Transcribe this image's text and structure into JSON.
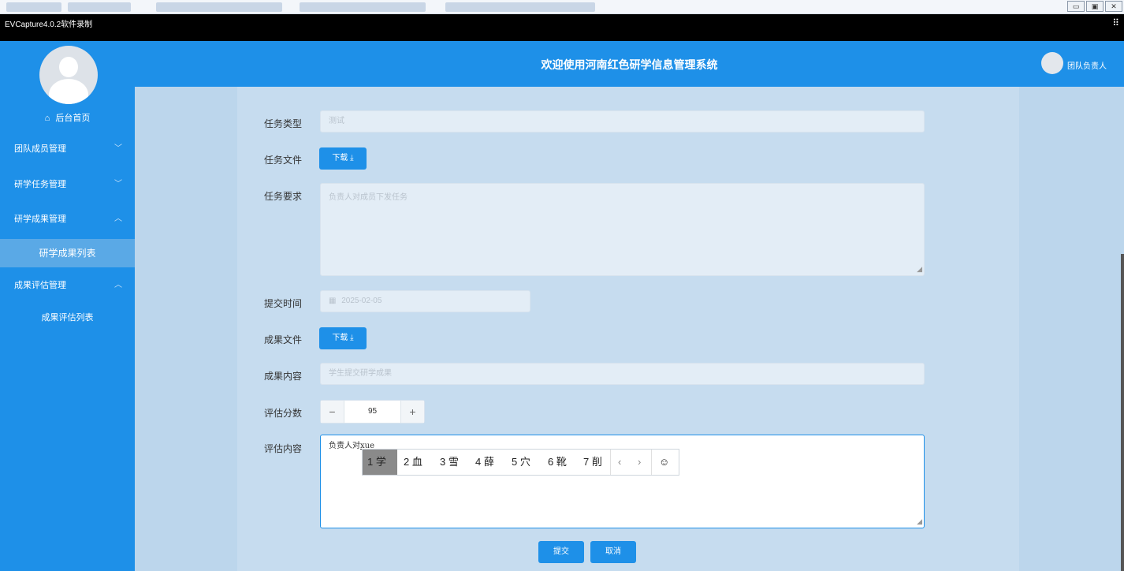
{
  "os": {
    "window_controls": [
      "▭",
      "▣",
      "✕"
    ]
  },
  "recorder": {
    "title": "EVCapture4.0.2软件录制",
    "icon": "fullscreen-exit-icon"
  },
  "header": {
    "title": "欢迎使用河南红色研学信息管理系统",
    "user": "团队负责人"
  },
  "sidebar": {
    "home": "后台首页",
    "groups": [
      {
        "label": "团队成员管理",
        "chevron": "﹀"
      },
      {
        "label": "研学任务管理",
        "chevron": "﹀"
      },
      {
        "label": "研学成果管理",
        "chevron": "︿"
      },
      {
        "label": "成果评估管理",
        "chevron": "︿"
      }
    ],
    "subs": {
      "results_list": "研学成果列表",
      "eval_list": "成果评估列表"
    }
  },
  "form": {
    "task_type_label": "任务类型",
    "task_type_value": "测试",
    "task_file_label": "任务文件",
    "download_label": "下载 ⤓",
    "task_req_label": "任务要求",
    "task_req_value": "负责人对成员下发任务",
    "submit_time_label": "提交时间",
    "submit_time_value": "2025-02-05",
    "result_file_label": "成果文件",
    "result_content_label": "成果内容",
    "result_content_value": "学生提交研学成果",
    "score_label": "评估分数",
    "score_value": "95",
    "eval_content_label": "评估内容",
    "eval_typed": "负责人对",
    "eval_composing": "xue",
    "submit_label": "提交",
    "cancel_label": "取消"
  },
  "ime": {
    "candidates": [
      "1 学",
      "2 血",
      "3 雪",
      "4 薛",
      "5 穴",
      "6 靴",
      "7 削"
    ],
    "prev": "‹",
    "next": "›",
    "emoji": "☺"
  },
  "colors": {
    "primary": "#1e90e8",
    "content_bg": "#bcd6ec"
  }
}
